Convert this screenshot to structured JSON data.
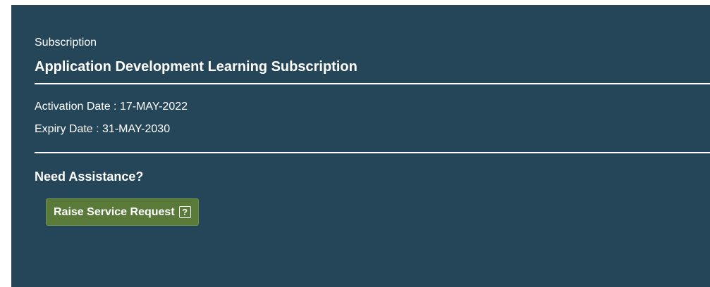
{
  "subscription": {
    "label": "Subscription",
    "name": "Application Development Learning Subscription",
    "activation": "Activation Date : 17-MAY-2022",
    "expiry": "Expiry Date : 31-MAY-2030"
  },
  "assistance": {
    "heading": "Need Assistance?",
    "button_label": "Raise Service Request",
    "help_glyph": "?"
  },
  "colors": {
    "panel_bg": "#244658",
    "button_bg": "#5a7a3a",
    "text": "#ffffff"
  },
  "icons": {
    "help": "help-icon"
  }
}
